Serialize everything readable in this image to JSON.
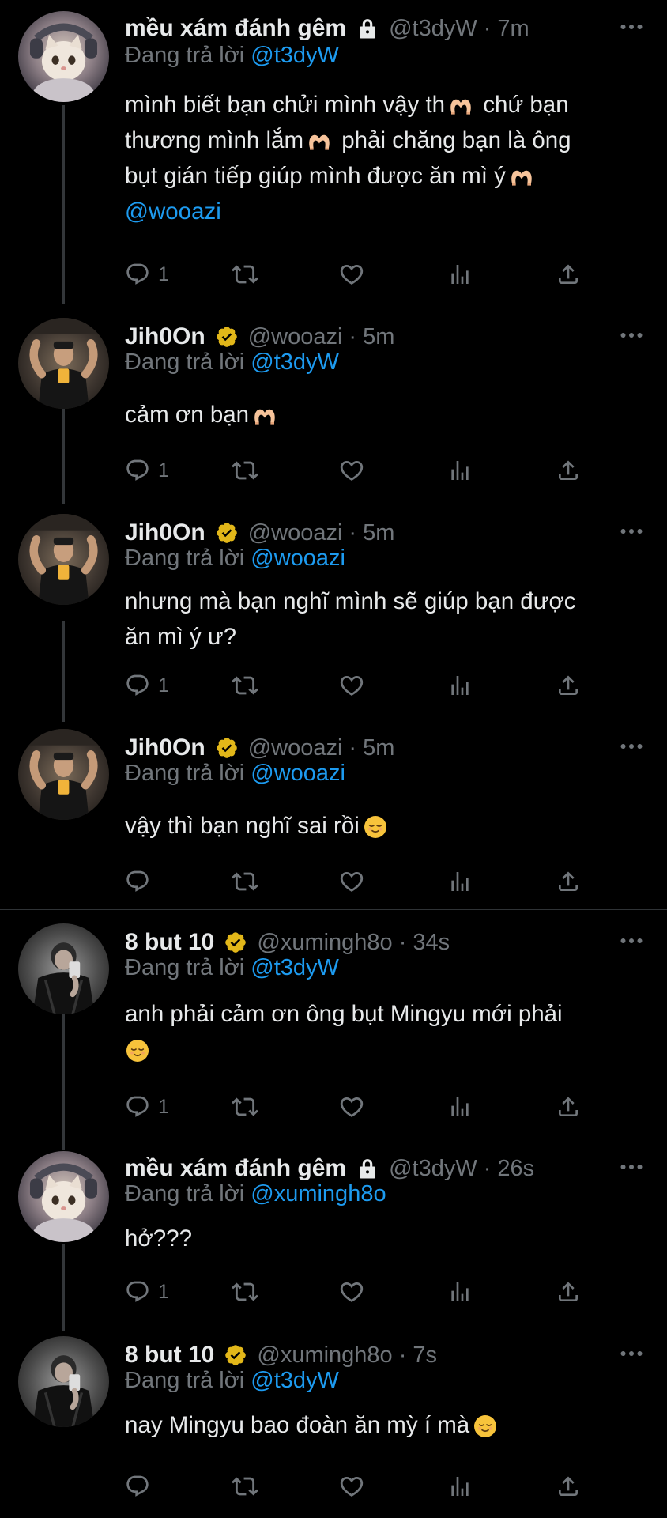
{
  "reply_prefix": "Đang trả lời",
  "colors": {
    "background": "#000000",
    "text": "#e7e9ea",
    "muted": "#71767b",
    "link": "#1d9bf0",
    "verified_gold": "#e2b719"
  },
  "tweets": [
    {
      "display_name": "mều xám đánh gêm",
      "badge": "lock-icon",
      "handle": "@t3dyW",
      "time": "7m",
      "reply_to": "@t3dyW",
      "text_lines": [
        "mình biết bạn chửi mình vậy th",
        "chứ bạn",
        "thương mình lắm",
        "phải chăng bạn là ông",
        "bụt gián tiếp giúp mình được ăn mì ý",
        "@wooazi"
      ],
      "reply_count": "1"
    },
    {
      "display_name": "Jih0On",
      "badge": "verified-badge-icon",
      "handle": "@wooazi",
      "time": "5m",
      "reply_to": "@t3dyW",
      "text": "cảm ơn bạn",
      "reply_count": "1"
    },
    {
      "display_name": "Jih0On",
      "badge": "verified-badge-icon",
      "handle": "@wooazi",
      "time": "5m",
      "reply_to": "@wooazi",
      "text_lines": [
        "nhưng mà bạn nghĩ mình sẽ giúp bạn được",
        "ăn mì ý ư?"
      ],
      "reply_count": "1"
    },
    {
      "display_name": "Jih0On",
      "badge": "verified-badge-icon",
      "handle": "@wooazi",
      "time": "5m",
      "reply_to": "@wooazi",
      "text": "vậy thì bạn nghĩ sai rồi",
      "reply_count": ""
    },
    {
      "display_name": "8 but 10",
      "badge": "verified-badge-icon",
      "handle": "@xumingh8o",
      "time": "34s",
      "reply_to": "@t3dyW",
      "text_lines": [
        "anh phải cảm ơn ông bụt Mingyu mới phải"
      ],
      "reply_count": "1"
    },
    {
      "display_name": "mều xám đánh gêm",
      "badge": "lock-icon",
      "handle": "@t3dyW",
      "time": "26s",
      "reply_to": "@xumingh8o",
      "text": "hở???",
      "reply_count": "1"
    },
    {
      "display_name": "8 but 10",
      "badge": "verified-badge-icon",
      "handle": "@xumingh8o",
      "time": "7s",
      "reply_to": "@t3dyW",
      "text": "nay Mingyu bao đoàn ăn mỳ í mà",
      "reply_count": ""
    }
  ]
}
